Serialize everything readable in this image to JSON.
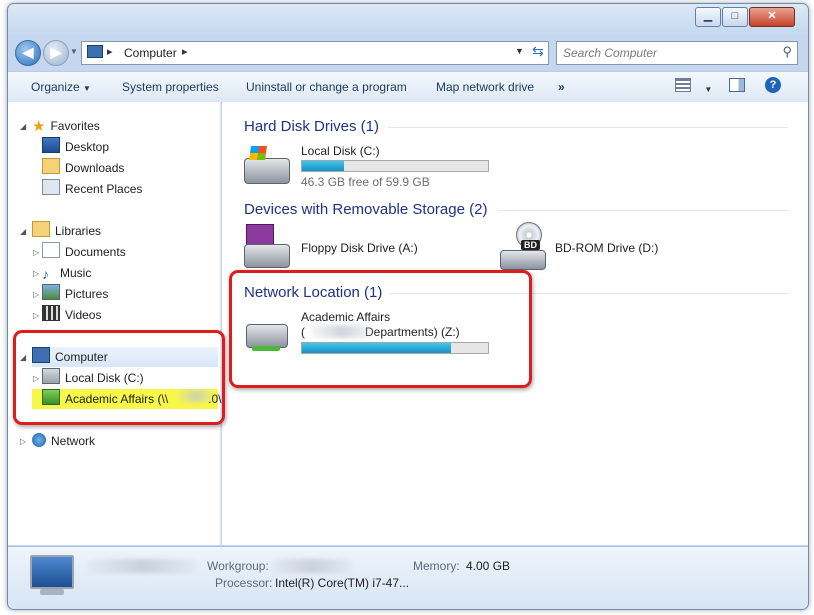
{
  "window": {
    "caption_buttons": {
      "minimize": "▁",
      "maximize": "□",
      "close": "✕"
    }
  },
  "address": {
    "path_label": "Computer",
    "separator": "▸",
    "search_placeholder": "Search Computer"
  },
  "toolbar": {
    "organize": "Organize",
    "system_properties": "System properties",
    "uninstall": "Uninstall or change a program",
    "map_network_drive": "Map network drive",
    "more": "»"
  },
  "nav": {
    "favorites": "Favorites",
    "desktop": "Desktop",
    "downloads": "Downloads",
    "recent_places": "Recent Places",
    "libraries": "Libraries",
    "documents": "Documents",
    "music": "Music",
    "pictures": "Pictures",
    "videos": "Videos",
    "computer": "Computer",
    "local_disk": "Local Disk (C:)",
    "academic_affairs": "Academic Affairs (\\\\",
    "academic_affairs_tail": ".0\\",
    "network": "Network"
  },
  "content": {
    "hard_disk_header": "Hard Disk Drives (1)",
    "local_disk_name": "Local Disk (C:)",
    "local_disk_free": "46.3 GB free of 59.9 GB",
    "local_disk_fill": 0.227,
    "removable_header": "Devices with Removable Storage (2)",
    "floppy_name": "Floppy Disk Drive (A:)",
    "bdrom_name": "BD-ROM Drive (D:)",
    "bd_badge": "BD",
    "network_header": "Network Location (1)",
    "network_name_line1": "Academic Affairs",
    "network_name_line2_start": "(",
    "network_name_line2_end": "Departments) (Z:)",
    "network_fill": 0.8
  },
  "details": {
    "workgroup_label": "Workgroup:",
    "memory_label": "Memory:",
    "memory_value": "4.00 GB",
    "processor_label": "Processor:",
    "processor_value": "Intel(R) Core(TM) i7-47..."
  },
  "colors": {
    "annotation_red": "#dd1c1c",
    "highlight_yellow": "#f7f74a",
    "header_blue": "#1e3287"
  }
}
